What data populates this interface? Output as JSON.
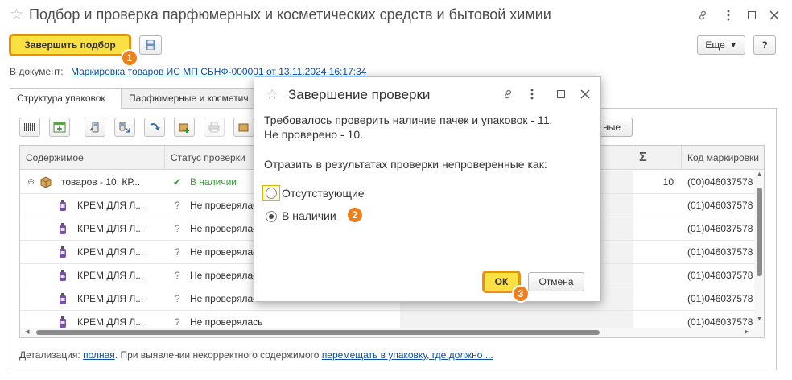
{
  "window": {
    "title": "Подбор и проверка парфюмерных и косметических средств и бытовой химии"
  },
  "toolbar": {
    "finish_label": "Завершить подбор",
    "more_label": "Еще",
    "help_label": "?"
  },
  "document": {
    "prefix": "В документ:",
    "link": "Маркировка товаров ИС МП СБНФ-000001 от 13.11.2024 16:17:34"
  },
  "tabs": [
    {
      "label": "Структура упаковок"
    },
    {
      "label": "Парфюмерные и косметич"
    }
  ],
  "partial_button_label": "ные",
  "grid": {
    "headers": {
      "content": "Содержимое",
      "status": "Статус проверки",
      "sum_symbol": "Σ",
      "code": "Код маркировки"
    },
    "group_row": {
      "content": "товаров - 10, КР...",
      "status": "В наличии",
      "count": "10",
      "code": "(00)046037578"
    },
    "rows": [
      {
        "content": "КРЕМ ДЛЯ Л...",
        "status": "Не проверялась",
        "code": "(01)046037578"
      },
      {
        "content": "КРЕМ ДЛЯ Л...",
        "status": "Не проверялась",
        "code": "(01)046037578"
      },
      {
        "content": "КРЕМ ДЛЯ Л...",
        "status": "Не проверялась",
        "code": "(01)046037578"
      },
      {
        "content": "КРЕМ ДЛЯ Л...",
        "status": "Не проверялась",
        "code": "(01)046037578"
      },
      {
        "content": "КРЕМ ДЛЯ Л...",
        "status": "Не проверялась",
        "code": "(01)046037578"
      },
      {
        "content": "КРЕМ ДЛЯ Л...",
        "status": "Не проверялась",
        "code": "(01)046037578"
      }
    ]
  },
  "footer": {
    "prefix": "Детализация:",
    "link1": "полная",
    "middle": ". При выявлении некорректного содержимого",
    "link2": "перемещать в упаковку, где должно ..."
  },
  "modal": {
    "title": "Завершение проверки",
    "line1": "Требовалось проверить наличие пачек и упаковок - 11.",
    "line2": "Не проверено - 10.",
    "question": "Отразить в результатах проверки непроверенные как:",
    "options": [
      {
        "label": "Отсутствующие",
        "selected": false
      },
      {
        "label": "В наличии",
        "selected": true
      }
    ],
    "ok_label": "ОК",
    "cancel_label": "Отмена"
  },
  "badges": [
    "1",
    "2",
    "3"
  ],
  "colors": {
    "accent_yellow": "#fbe044",
    "badge_orange": "#f0801b",
    "link_blue": "#0d4fa0",
    "check_green": "#3a9a3a"
  }
}
